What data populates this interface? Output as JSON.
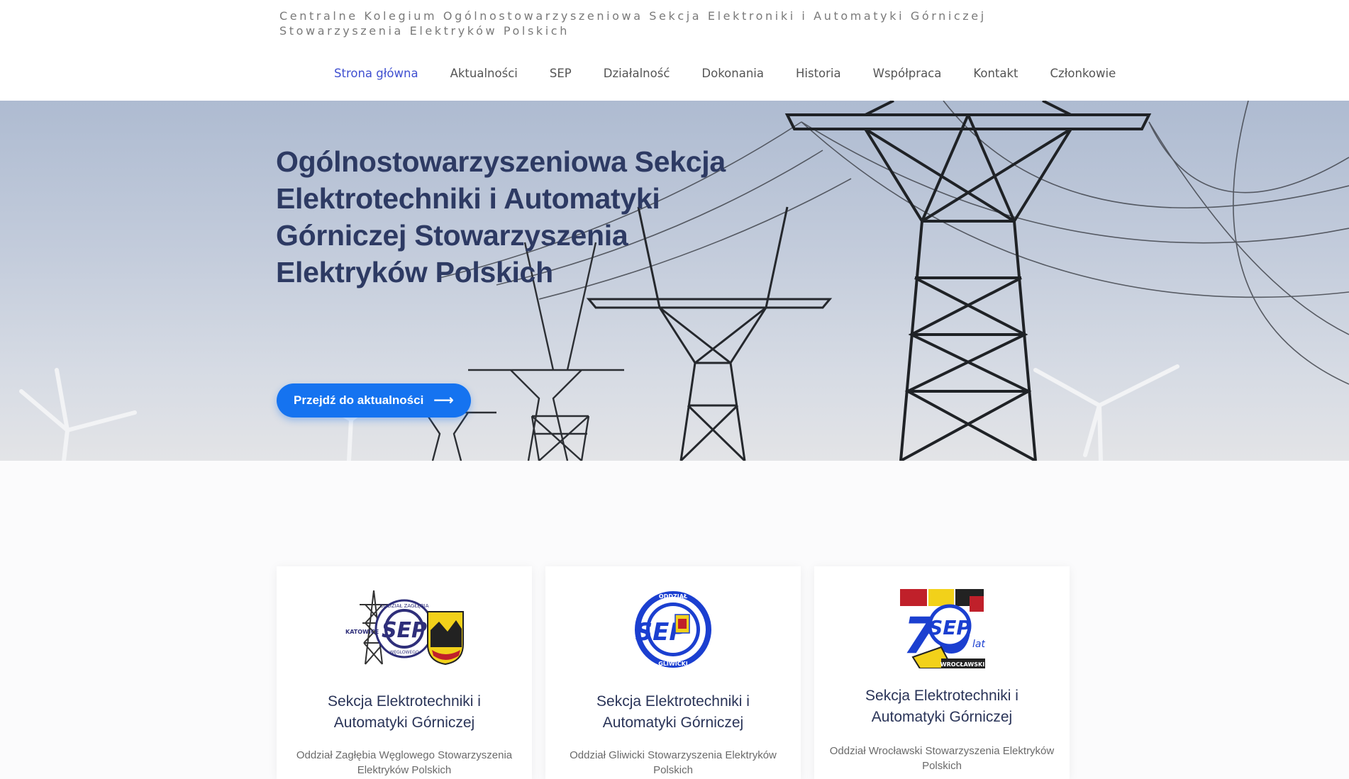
{
  "site": {
    "title": "Centralne Kolegium Ogólnostowarzyszeniowa Sekcja Elektroniki i Automatyki Górniczej Stowarzyszenia Elektryków Polskich"
  },
  "nav": {
    "items": [
      {
        "label": "Strona główna",
        "active": true
      },
      {
        "label": "Aktualności"
      },
      {
        "label": "SEP"
      },
      {
        "label": "Działalność"
      },
      {
        "label": "Dokonania"
      },
      {
        "label": "Historia"
      },
      {
        "label": "Współpraca"
      },
      {
        "label": "Kontakt"
      },
      {
        "label": "Członkowie"
      }
    ]
  },
  "hero": {
    "title": "Ogólnostowarzyszeniowa Sekcja Elektrotechniki i Automatyki Górniczej Stowarzyszenia Elektryków Polskich",
    "button_label": "Przejdź do aktualności",
    "button_icon": "arrow-right-icon"
  },
  "cards": [
    {
      "title": "Sekcja Elektrotechniki i Automatyki Górniczej",
      "desc": "Oddział Zagłębia Węglowego Stowarzyszenia Elektryków Polskich",
      "logo_text_top": "ODDZIAŁ ZAGŁĘBIA",
      "logo_text_bottom": "WĘGLOWEGO",
      "logo_text_left": "KATOWICE",
      "logo_mark": "SEP"
    },
    {
      "title": "Sekcja Elektrotechniki i Automatyki Górniczej",
      "desc": "Oddział Gliwicki Stowarzyszenia Elektryków Polskich",
      "logo_text_top": "ODDZIAŁ",
      "logo_text_bottom": "GLIWICKI",
      "logo_mark": "SEP"
    },
    {
      "title": "Sekcja Elektrotechniki i Automatyki Górniczej",
      "desc": "Oddział Wrocławski Stowarzyszenia Elektryków Polskich",
      "logo_mark": "SEP",
      "logo_number": "70",
      "logo_suffix": "lat",
      "logo_city": "WROCŁAWSKI"
    }
  ],
  "colors": {
    "accent": "#1573f0",
    "nav_active": "#4050d0",
    "heading": "#2d3a63",
    "logo_blue": "#1b3fd0"
  }
}
